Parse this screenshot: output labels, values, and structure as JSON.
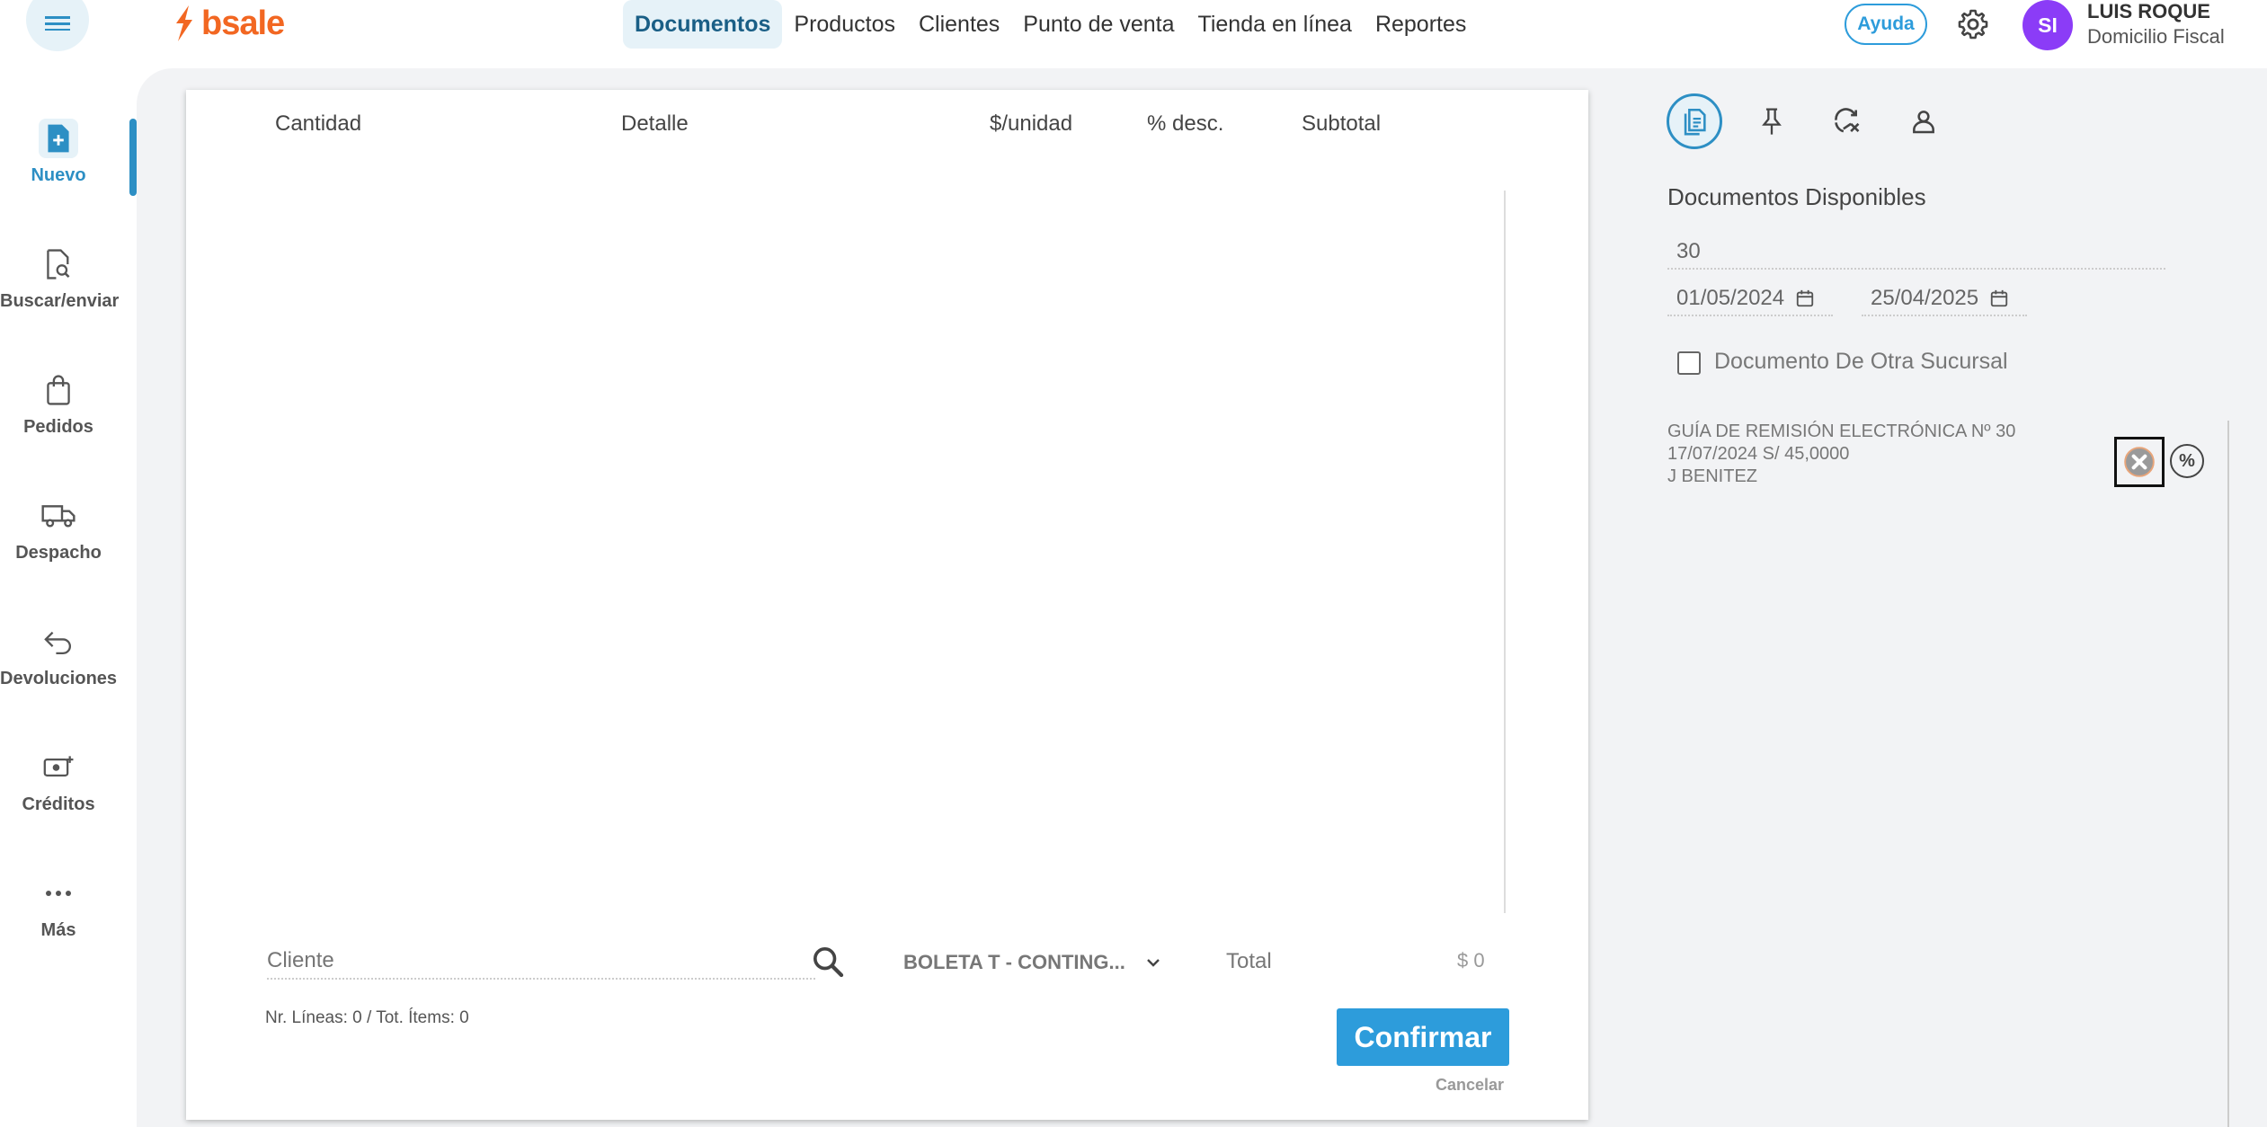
{
  "header": {
    "logo_text": "bsale",
    "nav": [
      {
        "label": "Documentos",
        "active": true
      },
      {
        "label": "Productos"
      },
      {
        "label": "Clientes"
      },
      {
        "label": "Punto de venta"
      },
      {
        "label": "Tienda en línea"
      },
      {
        "label": "Reportes"
      }
    ],
    "help_label": "Ayuda",
    "avatar_initials": "SI",
    "user_name": "LUIS ROQUE",
    "user_subtitle": "Domicilio Fiscal"
  },
  "sidebar": {
    "items": [
      {
        "label": "Nuevo",
        "icon": "new-document-icon",
        "active": true
      },
      {
        "label": "Buscar/enviar",
        "icon": "search-document-icon"
      },
      {
        "label": "Pedidos",
        "icon": "shopping-bag-icon"
      },
      {
        "label": "Despacho",
        "icon": "truck-icon"
      },
      {
        "label": "Devoluciones",
        "icon": "return-arrow-icon"
      },
      {
        "label": "Créditos",
        "icon": "money-plus-icon"
      },
      {
        "label": "Más",
        "icon": "more-dots-icon"
      }
    ]
  },
  "document": {
    "columns": [
      "Cantidad",
      "Detalle",
      "$/unidad",
      "% desc.",
      "Subtotal"
    ],
    "client_placeholder": "Cliente",
    "doc_type": "BOLETA T - CONTING...",
    "total_label": "Total",
    "total_value": "$ 0",
    "lines_info": "Nr. Líneas: 0 / Tot. Ítems: 0",
    "confirm_label": "Confirmar",
    "cancel_label": "Cancelar"
  },
  "right_panel": {
    "icons": [
      "documents-icon",
      "pin-icon",
      "sync-off-icon",
      "user-icon"
    ],
    "title": "Documentos Disponibles",
    "number_filter": "30",
    "date_from": "01/05/2024",
    "date_to": "25/04/2025",
    "other_branch_label": "Documento De Otra Sucursal",
    "entry": {
      "line1": "GUÍA DE REMISIÓN ELECTRÓNICA Nº 30",
      "line2": "17/07/2024 S/ 45,0000",
      "line3": "J BENITEZ"
    },
    "percent_symbol": "%"
  },
  "colors": {
    "accent": "#2d9cdb",
    "brand": "#f26722",
    "avatar": "#8b3cf7"
  }
}
